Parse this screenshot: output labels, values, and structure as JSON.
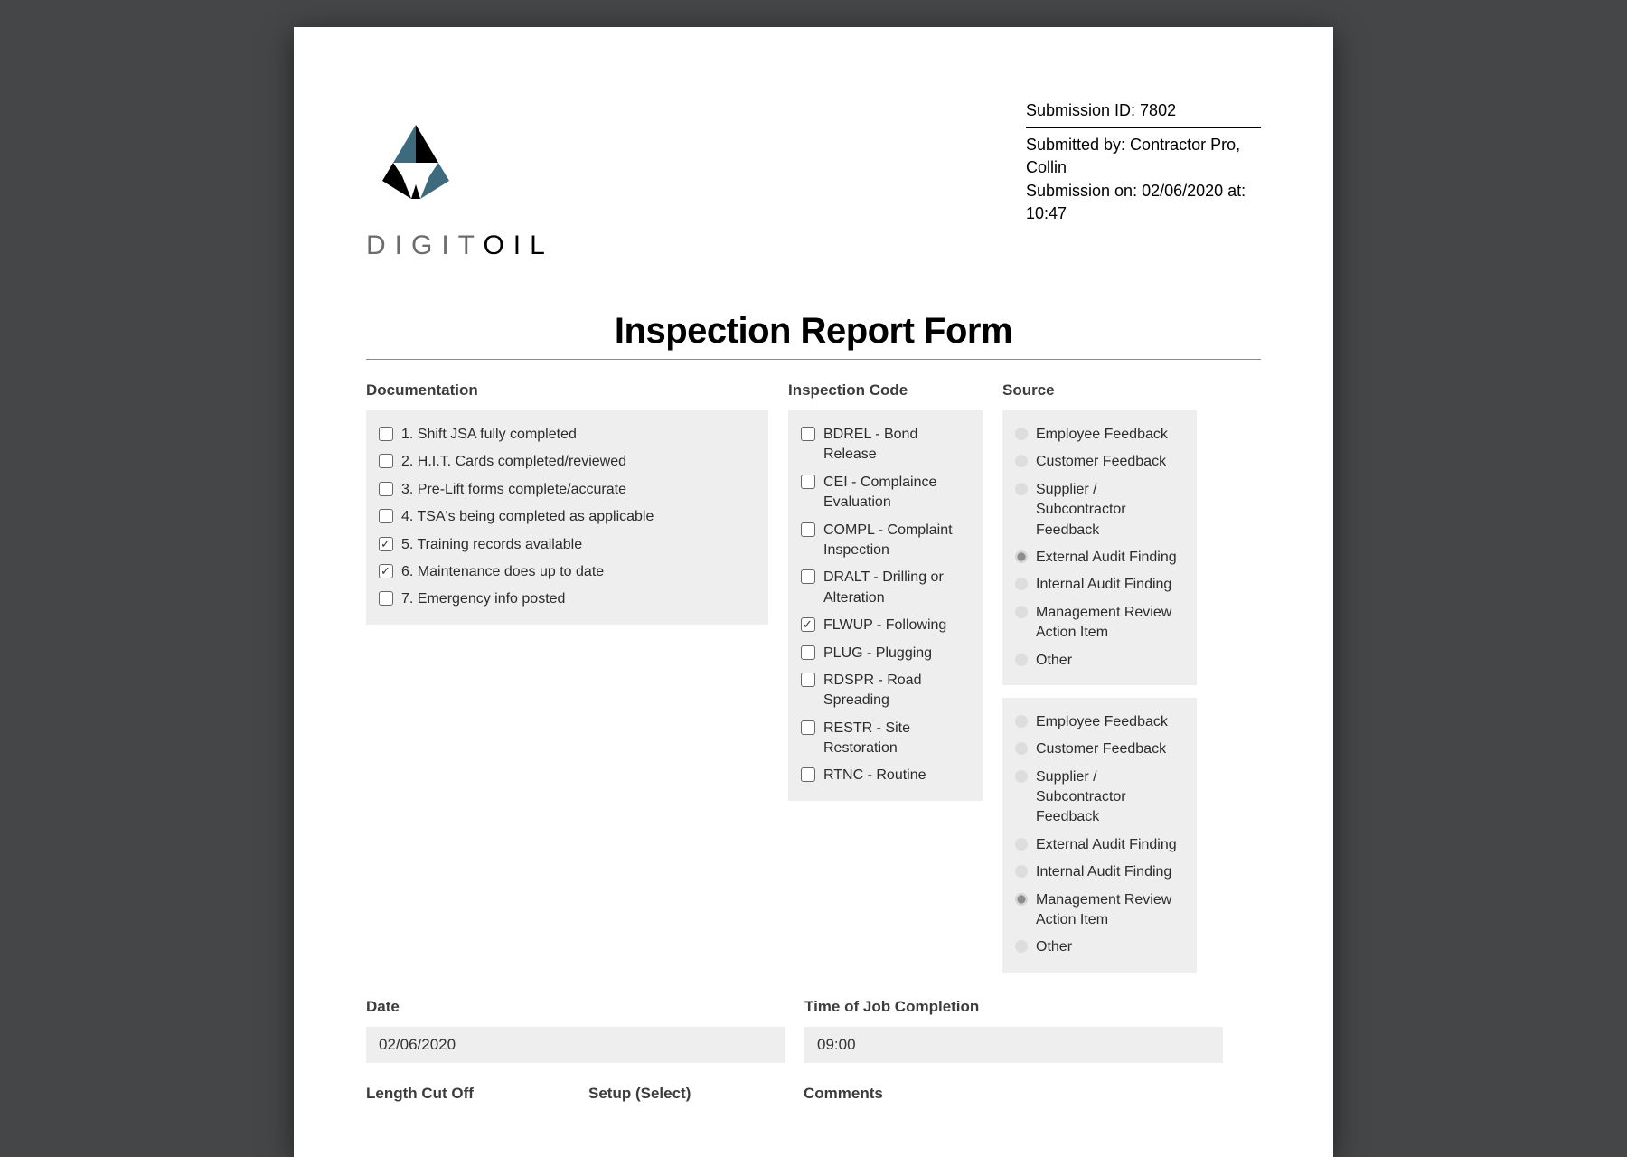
{
  "meta": {
    "submission_id_label": "Submission ID: 7802",
    "submitted_by": "Submitted by: Contractor Pro, Collin",
    "submitted_on": "Submission on: 02/06/2020 at: 10:47"
  },
  "logo": {
    "part1": "DIGIT",
    "part2": "OIL"
  },
  "title": "Inspection Report Form",
  "documentation": {
    "label": "Documentation",
    "items": [
      {
        "text": "1. Shift JSA fully completed",
        "checked": false
      },
      {
        "text": "2. H.I.T. Cards completed/reviewed",
        "checked": false
      },
      {
        "text": "3. Pre-Lift forms complete/accurate",
        "checked": false
      },
      {
        "text": "4. TSA's being completed as applicable",
        "checked": false
      },
      {
        "text": "5. Training records available",
        "checked": true
      },
      {
        "text": "6. Maintenance does up to date",
        "checked": true
      },
      {
        "text": "7. Emergency info posted",
        "checked": false
      }
    ]
  },
  "inspection_code": {
    "label": "Inspection Code",
    "items": [
      {
        "text": "BDREL - Bond Release",
        "checked": false
      },
      {
        "text": "CEI - Complaince Evaluation",
        "checked": false
      },
      {
        "text": "COMPL - Complaint Inspection",
        "checked": false
      },
      {
        "text": "DRALT - Drilling or Alteration",
        "checked": false
      },
      {
        "text": "FLWUP - Following",
        "checked": true
      },
      {
        "text": "PLUG - Plugging",
        "checked": false
      },
      {
        "text": "RDSPR - Road Spreading",
        "checked": false
      },
      {
        "text": "RESTR - Site Restoration",
        "checked": false
      },
      {
        "text": "RTNC - Routine",
        "checked": false
      }
    ]
  },
  "source": {
    "label": "Source",
    "group1": [
      {
        "text": "Employee Feedback",
        "selected": false
      },
      {
        "text": "Customer Feedback",
        "selected": false
      },
      {
        "text": "Supplier / Subcontractor Feedback",
        "selected": false
      },
      {
        "text": "External Audit Finding",
        "selected": true
      },
      {
        "text": "Internal Audit Finding",
        "selected": false
      },
      {
        "text": "Management Review Action Item",
        "selected": false
      },
      {
        "text": "Other",
        "selected": false
      }
    ],
    "group2": [
      {
        "text": "Employee Feedback",
        "selected": false
      },
      {
        "text": "Customer Feedback",
        "selected": false
      },
      {
        "text": "Supplier / Subcontractor Feedback",
        "selected": false
      },
      {
        "text": "External Audit Finding",
        "selected": false
      },
      {
        "text": "Internal Audit Finding",
        "selected": false
      },
      {
        "text": "Management Review Action Item",
        "selected": true
      },
      {
        "text": "Other",
        "selected": false
      }
    ]
  },
  "fields": {
    "date_label": "Date",
    "date_value": "02/06/2020",
    "time_label": "Time of Job Completion",
    "time_value": "09:00",
    "cutoff1": "Length Cut Off",
    "cutoff2": "Setup (Select)",
    "cutoff3": "Comments"
  }
}
